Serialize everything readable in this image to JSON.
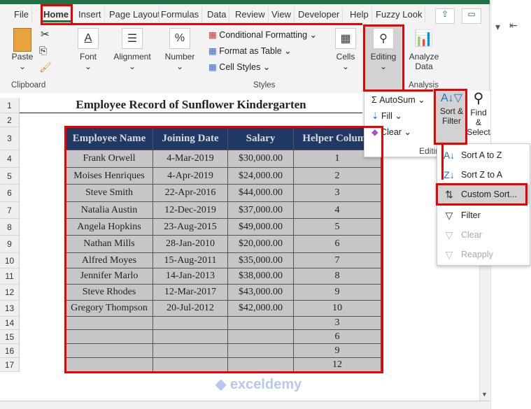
{
  "ribbon": {
    "tabs": [
      "File",
      "Home",
      "Insert",
      "Page Layout",
      "Formulas",
      "Data",
      "Review",
      "View",
      "Developer",
      "Help",
      "Fuzzy Look"
    ],
    "active_tab": "Home",
    "clipboard": {
      "paste": "Paste",
      "label": "Clipboard"
    },
    "font": "Font",
    "alignment": "Alignment",
    "number": "Number",
    "styles": {
      "conditional": "Conditional Formatting",
      "format_table": "Format as Table",
      "cell_styles": "Cell Styles",
      "label": "Styles"
    },
    "cells": "Cells",
    "editing": "Editing",
    "analysis": {
      "analyze": "Analyze Data",
      "label": "Analysis"
    }
  },
  "editing_panel": {
    "autosum": "AutoSum",
    "fill": "Fill",
    "clear": "Clear",
    "label": "Editing",
    "sort_filter": "Sort & Filter",
    "find_select": "Find & Select"
  },
  "sort_menu": {
    "items": [
      {
        "label": "Sort A to Z",
        "icon": "sort-a-z-icon",
        "enabled": true
      },
      {
        "label": "Sort Z to A",
        "icon": "sort-z-a-icon",
        "enabled": true
      },
      {
        "label": "Custom Sort...",
        "icon": "custom-sort-icon",
        "enabled": true,
        "highlighted": true
      },
      {
        "label": "Filter",
        "icon": "filter-icon",
        "enabled": true
      },
      {
        "label": "Clear",
        "icon": "clear-filter-icon",
        "enabled": false
      },
      {
        "label": "Reapply",
        "icon": "reapply-icon",
        "enabled": false
      }
    ]
  },
  "sheet": {
    "title": "Employee Record of Sunflower Kindergarten",
    "row_numbers": [
      "1",
      "2",
      "3",
      "4",
      "5",
      "6",
      "7",
      "8",
      "9",
      "10",
      "11",
      "12",
      "13",
      "14",
      "15",
      "16",
      "17"
    ],
    "headers": [
      "Employee Name",
      "Joining Date",
      "Salary",
      "Helper Column"
    ],
    "rows": [
      [
        "Frank Orwell",
        "4-Mar-2019",
        "$30,000.00",
        "1"
      ],
      [
        "Moises Henriques",
        "4-Apr-2019",
        "$24,000.00",
        "2"
      ],
      [
        "Steve Smith",
        "22-Apr-2016",
        "$44,000.00",
        "3"
      ],
      [
        "Natalia Austin",
        "12-Dec-2019",
        "$37,000.00",
        "4"
      ],
      [
        "Angela Hopkins",
        "23-Aug-2015",
        "$49,000.00",
        "5"
      ],
      [
        "Nathan Mills",
        "28-Jan-2010",
        "$20,000.00",
        "6"
      ],
      [
        "Alfred Moyes",
        "15-Aug-2011",
        "$35,000.00",
        "7"
      ],
      [
        "Jennifer Marlo",
        "14-Jan-2013",
        "$38,000.00",
        "8"
      ],
      [
        "Steve Rhodes",
        "12-Mar-2017",
        "$43,000.00",
        "9"
      ],
      [
        "Gregory Thompson",
        "20-Jul-2012",
        "$42,000.00",
        "10"
      ],
      [
        "",
        "",
        "",
        "3"
      ],
      [
        "",
        "",
        "",
        "6"
      ],
      [
        "",
        "",
        "",
        "9"
      ],
      [
        "",
        "",
        "",
        "12"
      ]
    ]
  },
  "colors": {
    "header_bg": "#203864",
    "cell_bg": "#c6c6c6",
    "highlight": "#e00000",
    "excel_green": "#217346"
  }
}
